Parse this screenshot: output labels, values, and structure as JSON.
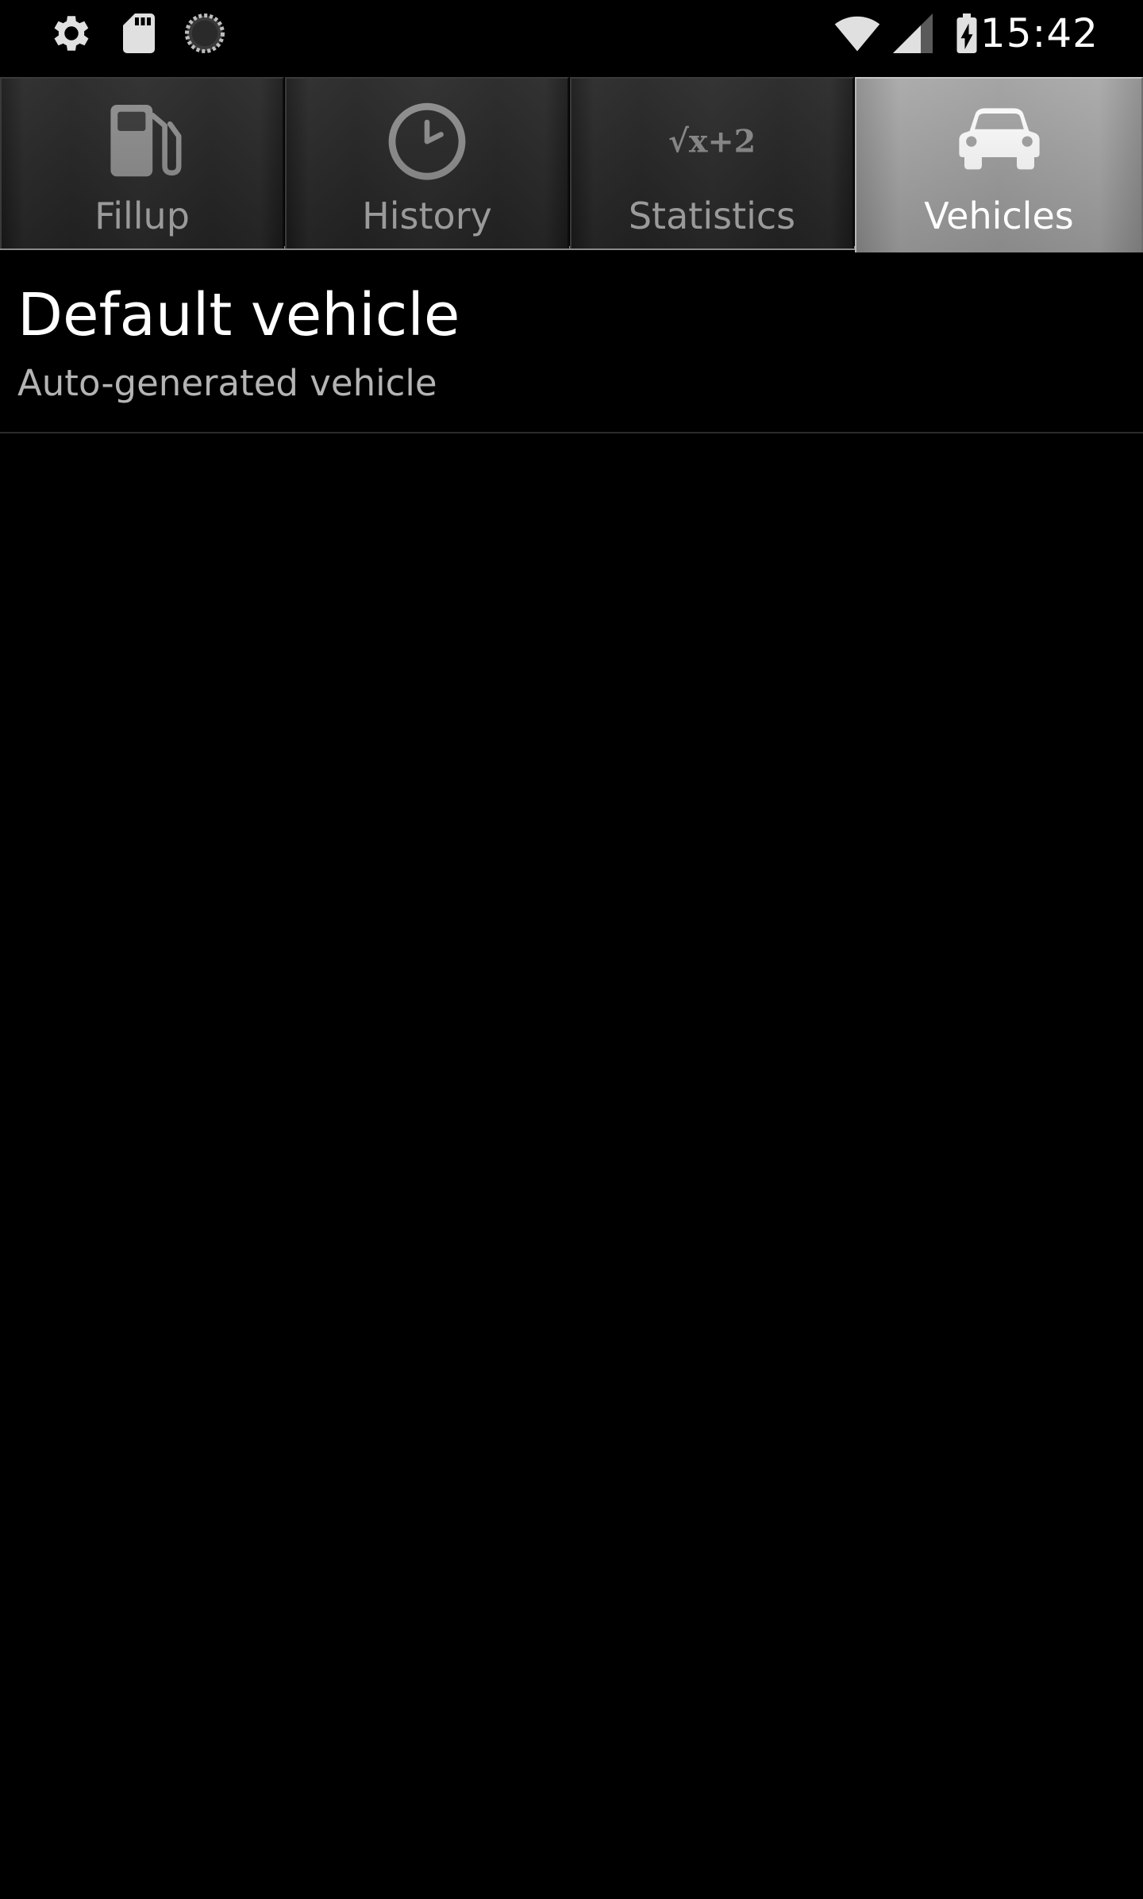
{
  "status_bar": {
    "time": "15:42",
    "left_icons": [
      "settings-icon",
      "sd-card-icon",
      "sync-progress-icon"
    ],
    "right_icons": [
      "wifi-icon",
      "cell-signal-icon",
      "battery-charging-icon"
    ]
  },
  "tabs": [
    {
      "label": "Fillup",
      "icon": "fuel-pump-icon",
      "selected": false
    },
    {
      "label": "History",
      "icon": "clock-icon",
      "selected": false
    },
    {
      "label": "Statistics",
      "icon": "sqrt-formula-icon",
      "selected": false
    },
    {
      "label": "Vehicles",
      "icon": "car-icon",
      "selected": true
    }
  ],
  "vehicles": [
    {
      "name": "Default vehicle",
      "description": "Auto-generated vehicle"
    }
  ],
  "statistics_icon_text": "√x+2",
  "colors": {
    "background": "#000000",
    "tab_inactive_label": "#9a9a9a",
    "tab_selected_bg": "#a5a5a5",
    "primary_text": "#ffffff",
    "secondary_text": "#b4b4b4",
    "divider": "#2b2b2b"
  }
}
